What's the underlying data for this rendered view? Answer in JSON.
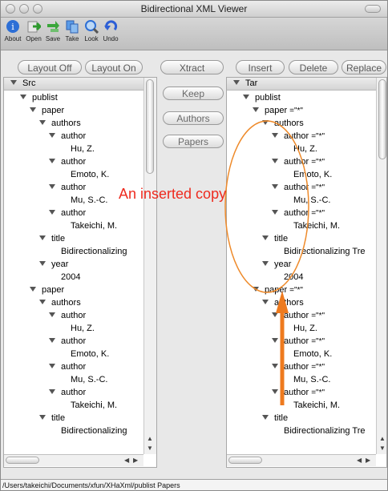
{
  "window": {
    "title": "Bidirectional XML Viewer"
  },
  "toolbar": {
    "items": [
      {
        "label": "About",
        "icon": "about-icon",
        "color": "#2d6fd6"
      },
      {
        "label": "Open",
        "icon": "open-icon",
        "color": "#3aa63a"
      },
      {
        "label": "Save",
        "icon": "save-icon",
        "color": "#3aa63a"
      },
      {
        "label": "Take",
        "icon": "take-icon",
        "color": "#2d7ad6"
      },
      {
        "label": "Look",
        "icon": "look-icon",
        "color": "#2d6fd6"
      },
      {
        "label": "Undo",
        "icon": "undo-icon",
        "color": "#2d5fd6"
      }
    ]
  },
  "buttons": {
    "layout_off": "Layout Off",
    "layout_on": "Layout On",
    "xtract": "Xtract",
    "insert": "Insert",
    "delete": "Delete",
    "replace": "Replace",
    "keep": "Keep",
    "authors": "Authors",
    "papers": "Papers"
  },
  "src": {
    "header": "Src",
    "rows": [
      {
        "level": 1,
        "text": "publist",
        "tri": true
      },
      {
        "level": 2,
        "text": "paper",
        "tri": true
      },
      {
        "level": 3,
        "text": "authors",
        "tri": true
      },
      {
        "level": 4,
        "text": "author",
        "tri": true
      },
      {
        "level": 5,
        "text": "Hu, Z.",
        "tri": false
      },
      {
        "level": 4,
        "text": "author",
        "tri": true
      },
      {
        "level": 5,
        "text": "Emoto, K.",
        "tri": false
      },
      {
        "level": 4,
        "text": "author",
        "tri": true
      },
      {
        "level": 5,
        "text": "Mu, S.-C.",
        "tri": false
      },
      {
        "level": 4,
        "text": "author",
        "tri": true
      },
      {
        "level": 5,
        "text": "Takeichi, M.",
        "tri": false
      },
      {
        "level": 3,
        "text": "title",
        "tri": true
      },
      {
        "level": 4,
        "text": "Bidirectionalizing",
        "tri": false
      },
      {
        "level": 3,
        "text": "year",
        "tri": true
      },
      {
        "level": 4,
        "text": "2004",
        "tri": false
      },
      {
        "level": 2,
        "text": "paper",
        "tri": true
      },
      {
        "level": 3,
        "text": "authors",
        "tri": true
      },
      {
        "level": 4,
        "text": "author",
        "tri": true
      },
      {
        "level": 5,
        "text": "Hu, Z.",
        "tri": false
      },
      {
        "level": 4,
        "text": "author",
        "tri": true
      },
      {
        "level": 5,
        "text": "Emoto, K.",
        "tri": false
      },
      {
        "level": 4,
        "text": "author",
        "tri": true
      },
      {
        "level": 5,
        "text": "Mu, S.-C.",
        "tri": false
      },
      {
        "level": 4,
        "text": "author",
        "tri": true
      },
      {
        "level": 5,
        "text": "Takeichi, M.",
        "tri": false
      },
      {
        "level": 3,
        "text": "title",
        "tri": true
      },
      {
        "level": 4,
        "text": "Bidirectionalizing",
        "tri": false
      }
    ]
  },
  "tar": {
    "header": "Tar",
    "rows": [
      {
        "level": 1,
        "text": "publist",
        "tri": true
      },
      {
        "level": 2,
        "text": "paper",
        "tri": true,
        "attr": "=\"*\""
      },
      {
        "level": 3,
        "text": "authors",
        "tri": true
      },
      {
        "level": 4,
        "text": "author",
        "tri": true,
        "attr": "=\"*\""
      },
      {
        "level": 5,
        "text": "Hu, Z.",
        "tri": false
      },
      {
        "level": 4,
        "text": "author",
        "tri": true,
        "attr": "=\"*\""
      },
      {
        "level": 5,
        "text": "Emoto, K.",
        "tri": false
      },
      {
        "level": 4,
        "text": "author",
        "tri": true,
        "attr": "=\"*\""
      },
      {
        "level": 5,
        "text": "Mu, S.-C.",
        "tri": false
      },
      {
        "level": 4,
        "text": "author",
        "tri": true,
        "attr": "=\"*\""
      },
      {
        "level": 5,
        "text": "Takeichi, M.",
        "tri": false
      },
      {
        "level": 3,
        "text": "title",
        "tri": true
      },
      {
        "level": 4,
        "text": "Bidirectionalizing Tre",
        "tri": false
      },
      {
        "level": 3,
        "text": "year",
        "tri": true
      },
      {
        "level": 4,
        "text": "2004",
        "tri": false
      },
      {
        "level": 2,
        "text": "paper",
        "tri": true,
        "attr": "=\"*\""
      },
      {
        "level": 3,
        "text": "authors",
        "tri": true
      },
      {
        "level": 4,
        "text": "author",
        "tri": true,
        "attr": "=\"*\""
      },
      {
        "level": 5,
        "text": "Hu, Z.",
        "tri": false
      },
      {
        "level": 4,
        "text": "author",
        "tri": true,
        "attr": "=\"*\""
      },
      {
        "level": 5,
        "text": "Emoto, K.",
        "tri": false
      },
      {
        "level": 4,
        "text": "author",
        "tri": true,
        "attr": "=\"*\""
      },
      {
        "level": 5,
        "text": "Mu, S.-C.",
        "tri": false
      },
      {
        "level": 4,
        "text": "author",
        "tri": true,
        "attr": "=\"*\""
      },
      {
        "level": 5,
        "text": "Takeichi, M.",
        "tri": false
      },
      {
        "level": 3,
        "text": "title",
        "tri": true
      },
      {
        "level": 4,
        "text": "Bidirectionalizing Tre",
        "tri": false
      }
    ]
  },
  "annotation": {
    "text": "An inserted copy",
    "color": "#ee2a1e",
    "ellipse_color": "#ee8a2a"
  },
  "status": {
    "path": "/Users/takeichi/Documents/xfun/XHaXml/publist  Papers"
  }
}
